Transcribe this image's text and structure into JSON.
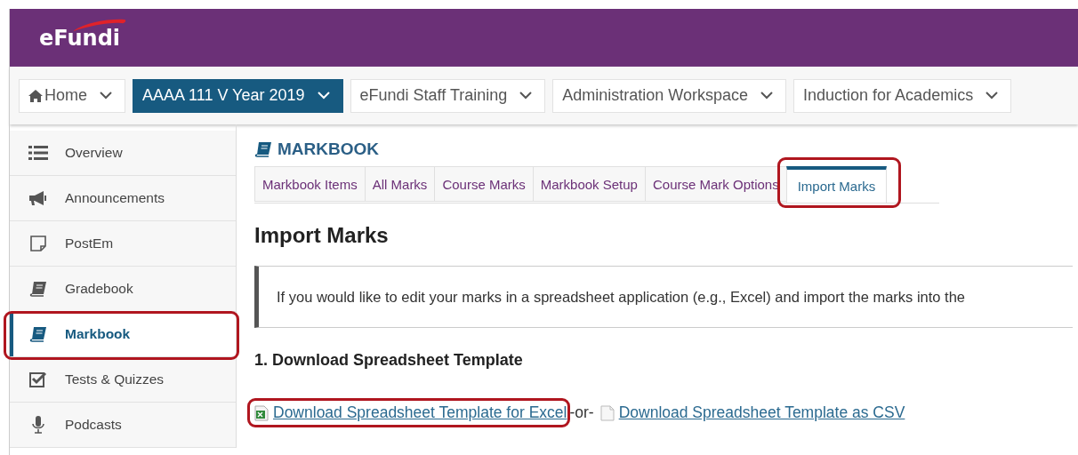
{
  "header": {
    "logo": "eFundi"
  },
  "sites": [
    {
      "label": "Home",
      "kind": "home",
      "selected": false
    },
    {
      "label": "AAAA 111 V Year 2019",
      "selected": true
    },
    {
      "label": "eFundi Staff Training",
      "selected": false
    },
    {
      "label": "Administration Workspace",
      "selected": false
    },
    {
      "label": "Induction for Academics",
      "selected": false
    }
  ],
  "sidebar": {
    "items": [
      {
        "label": "Overview",
        "kind": "list",
        "selected": false,
        "highlighted": false
      },
      {
        "label": "Announcements",
        "kind": "megaphone",
        "selected": false,
        "highlighted": false
      },
      {
        "label": "PostEm",
        "kind": "note",
        "selected": false,
        "highlighted": false
      },
      {
        "label": "Gradebook",
        "kind": "book",
        "selected": false,
        "highlighted": false
      },
      {
        "label": "Markbook",
        "kind": "book",
        "selected": true,
        "highlighted": true
      },
      {
        "label": "Tests & Quizzes",
        "kind": "check",
        "selected": false,
        "highlighted": false
      },
      {
        "label": "Podcasts",
        "kind": "mic",
        "selected": false,
        "highlighted": false
      }
    ]
  },
  "tool": {
    "title": "MARKBOOK",
    "tabs": [
      {
        "label": "Markbook Items",
        "selected": false,
        "highlighted": false
      },
      {
        "label": "All Marks",
        "selected": false,
        "highlighted": false
      },
      {
        "label": "Course Marks",
        "selected": false,
        "highlighted": false
      },
      {
        "label": "Markbook Setup",
        "selected": false,
        "highlighted": false
      },
      {
        "label": "Course Mark Options",
        "selected": false,
        "highlighted": false
      },
      {
        "label": "Import Marks",
        "selected": true,
        "highlighted": true
      }
    ]
  },
  "page": {
    "heading": "Import Marks",
    "info": "If you would like to edit your marks in a spreadsheet application (e.g., Excel) and import the marks into the",
    "step": "1. Download Spreadsheet Template",
    "links": [
      {
        "label": "Download Spreadsheet Template for Excel",
        "kind": "excel",
        "highlighted": true
      },
      {
        "label": "Download Spreadsheet Template as CSV",
        "kind": "file",
        "highlighted": false
      }
    ],
    "separator": "-or-"
  }
}
